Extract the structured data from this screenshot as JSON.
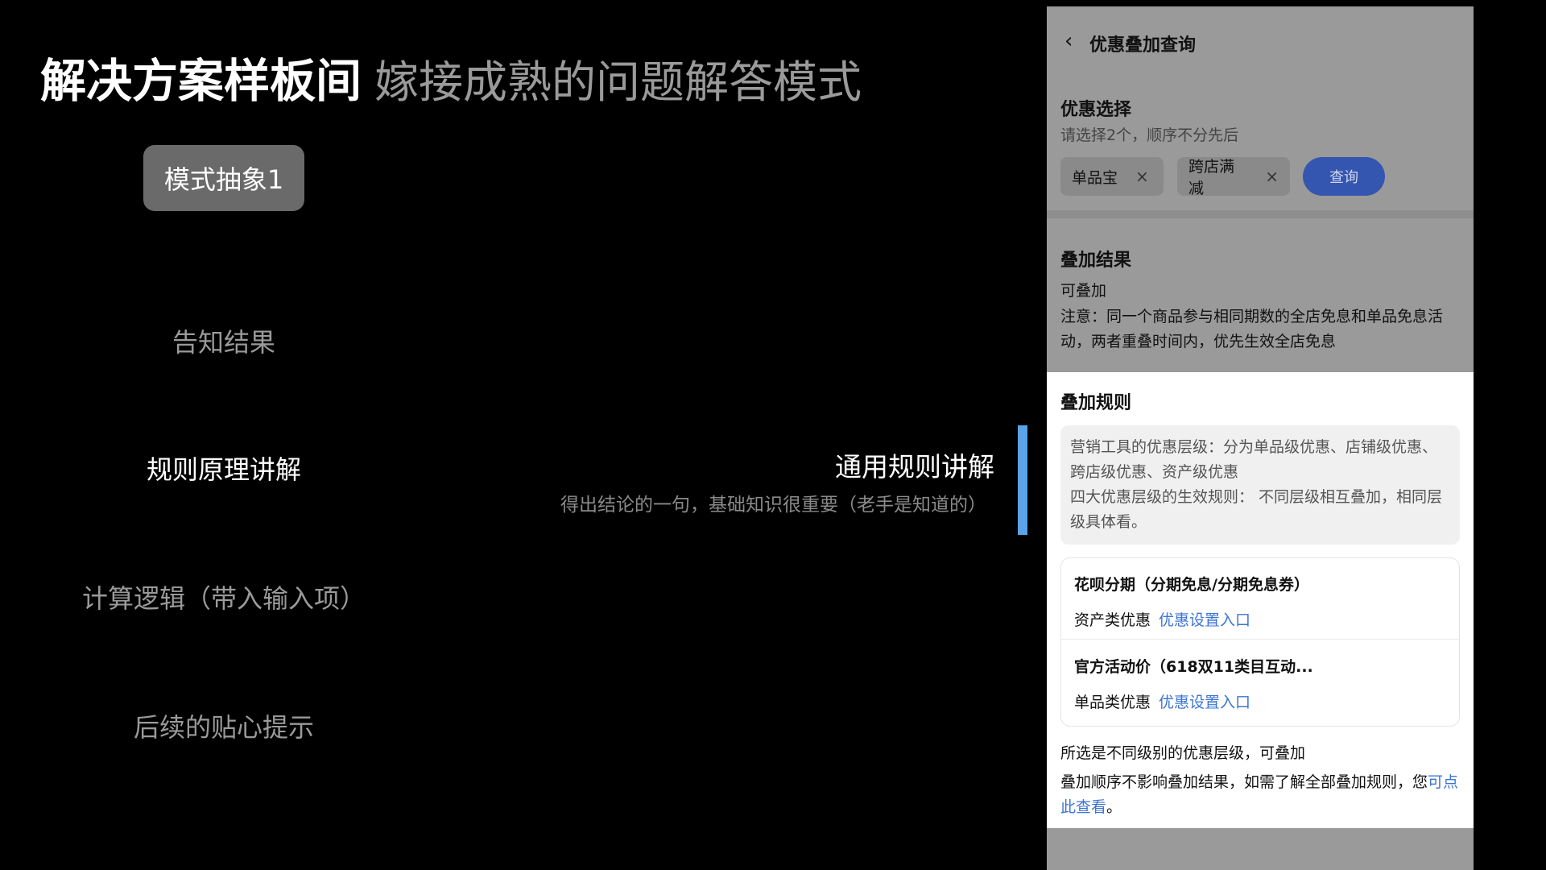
{
  "slide": {
    "title": "解决方案样板间",
    "subtitle": "嫁接成熟的问题解答模式",
    "pattern_button": "模式抽象1",
    "steps": [
      "告知结果",
      "规则原理讲解",
      "计算逻辑（带入输入项）",
      "后续的贴心提示"
    ],
    "callout_title": "通用规则讲解",
    "callout_desc": "得出结论的一句，基础知识很重要（老手是知道的）",
    "accent_color": "#5aa3e8"
  },
  "phone": {
    "nav_title": "优惠叠加查询",
    "selection": {
      "title": "优惠选择",
      "hint": "请选择2个，顺序不分先后",
      "chips": [
        "单品宝",
        "跨店满减"
      ],
      "query_label": "查询"
    },
    "result": {
      "title": "叠加结果",
      "status": "可叠加",
      "note": "注意：同一个商品参与相同期数的全店免息和单品免息活动，两者重叠时间内，优先生效全店免息"
    },
    "rules": {
      "title": "叠加规则",
      "line1": "营销工具的优惠层级：分为单品级优惠、店铺级优惠、跨店级优惠、资产级优惠",
      "line2": "四大优惠层级的生效规则： 不同层级相互叠加，相同层级具体看。",
      "items": [
        {
          "name": "花呗分期（分期免息/分期免息券）",
          "type": "资产类优惠",
          "link": "优惠设置入口"
        },
        {
          "name": "官方活动价（618双11类目互动...",
          "type": "单品类优惠",
          "link": "优惠设置入口"
        }
      ],
      "summary": "所选是不同级别的优惠层级，可叠加",
      "summary2_prefix": "叠加顺序不影响叠加结果，如需了解全部叠加规则，您",
      "summary2_link": "可点此查看",
      "summary2_suffix": "。"
    },
    "link_color": "#3b74d4",
    "primary_color": "#3556b0"
  }
}
